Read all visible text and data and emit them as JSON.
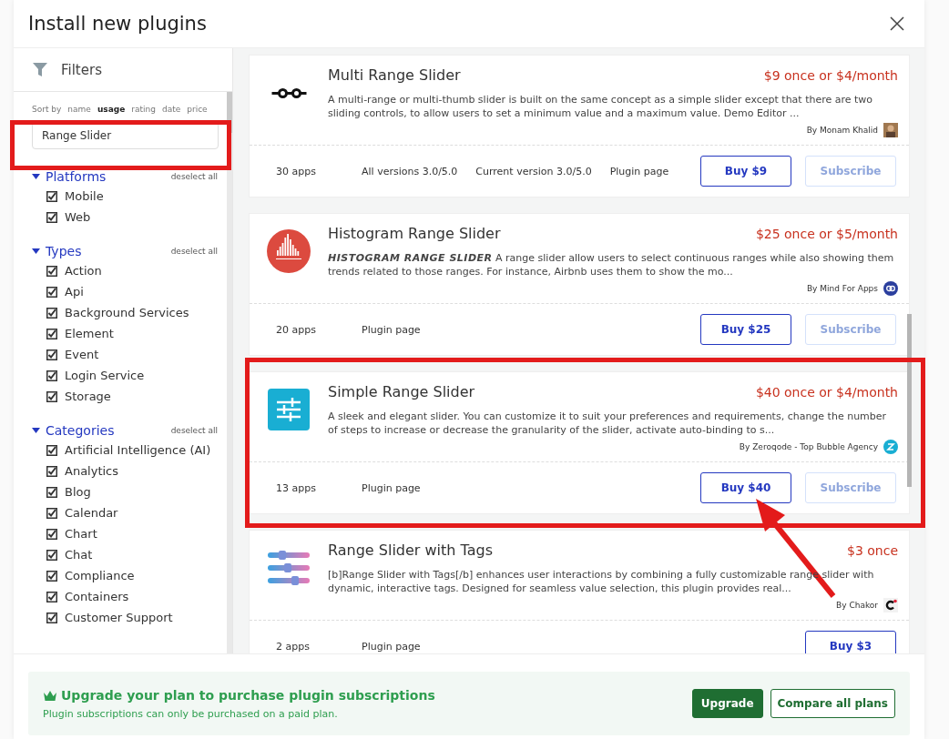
{
  "dialog": {
    "title": "Install new plugins"
  },
  "filters": {
    "title": "Filters",
    "sort_label": "Sort by",
    "sort_options": [
      {
        "label": "name",
        "selected": false
      },
      {
        "label": "usage",
        "selected": true
      },
      {
        "label": "rating",
        "selected": false
      },
      {
        "label": "date",
        "selected": false
      },
      {
        "label": "price",
        "selected": false
      }
    ],
    "search": {
      "value": "Range Slider"
    },
    "sections": [
      {
        "title": "Platforms",
        "expanded": true,
        "action": "deselect all",
        "items": [
          {
            "label": "Mobile",
            "checked": true
          },
          {
            "label": "Web",
            "checked": true
          }
        ]
      },
      {
        "title": "Types",
        "expanded": true,
        "action": "deselect all",
        "items": [
          {
            "label": "Action",
            "checked": true
          },
          {
            "label": "Api",
            "checked": true
          },
          {
            "label": "Background Services",
            "checked": true
          },
          {
            "label": "Element",
            "checked": true
          },
          {
            "label": "Event",
            "checked": true
          },
          {
            "label": "Login Service",
            "checked": true
          },
          {
            "label": "Storage",
            "checked": true
          }
        ]
      },
      {
        "title": "Categories",
        "expanded": true,
        "action": "deselect all",
        "items": [
          {
            "label": "Artificial Intelligence (AI)",
            "checked": true
          },
          {
            "label": "Analytics",
            "checked": true
          },
          {
            "label": "Blog",
            "checked": true
          },
          {
            "label": "Calendar",
            "checked": true
          },
          {
            "label": "Chart",
            "checked": true
          },
          {
            "label": "Chat",
            "checked": true
          },
          {
            "label": "Compliance",
            "checked": true
          },
          {
            "label": "Containers",
            "checked": true
          },
          {
            "label": "Customer Support",
            "checked": true
          }
        ]
      }
    ]
  },
  "plugins": [
    {
      "title": "Multi Range Slider",
      "price": "$9 once or $4/month",
      "description": "A multi-range or multi-thumb slider is built on the same concept as a simple slider except that there are two sliding controls, to allow users to set a minimum value and a maximum value. Demo Editor ...",
      "author": "By Monam Khalid",
      "apps": "30 apps",
      "links": [
        "All versions 3.0/5.0",
        "Current version 3.0/5.0",
        "Plugin page"
      ],
      "buy": "Buy $9",
      "subscribe": {
        "label": "Subscribe",
        "disabled": true
      }
    },
    {
      "title": "Histogram Range Slider",
      "price": "$25 once or $5/month",
      "description": "**HISTOGRAM RANGE SLIDER** A range slider allow users to select continuous ranges while also showing them trends related to those ranges. For instance, Airbnb uses them to show the mo...",
      "author": "By Mind For Apps",
      "apps": "20 apps",
      "links": [
        "Plugin page"
      ],
      "buy": "Buy $25",
      "subscribe": {
        "label": "Subscribe",
        "disabled": true
      }
    },
    {
      "title": "Simple Range Slider",
      "price": "$40 once or $4/month",
      "description": "A sleek and elegant slider. You can customize it to suit your preferences and requirements, change the number of steps to increase or decrease the granularity of the slider, activate auto-binding to s...",
      "author": "By Zeroqode - Top Bubble Agency",
      "apps": "13 apps",
      "links": [
        "Plugin page"
      ],
      "buy": "Buy $40",
      "subscribe": {
        "label": "Subscribe",
        "disabled": true
      }
    },
    {
      "title": "Range Slider with Tags",
      "price": "$3 once",
      "description": "[b]Range Slider with Tags[/b] enhances user interactions by combining a fully customizable range slider with dynamic, interactive tags. Designed for seamless value selection, this plugin provides real...",
      "author": "By Chakor",
      "apps": "2 apps",
      "links": [
        "Plugin page"
      ],
      "buy": "Buy $3"
    }
  ],
  "upgrade": {
    "title": "Upgrade your plan to purchase plugin subscriptions",
    "subtitle": "Plugin subscriptions can only be purchased on a paid plan.",
    "buttons": [
      {
        "label": "Upgrade",
        "kind": "primary"
      },
      {
        "label": "Compare all plans",
        "kind": "secondary"
      }
    ]
  }
}
